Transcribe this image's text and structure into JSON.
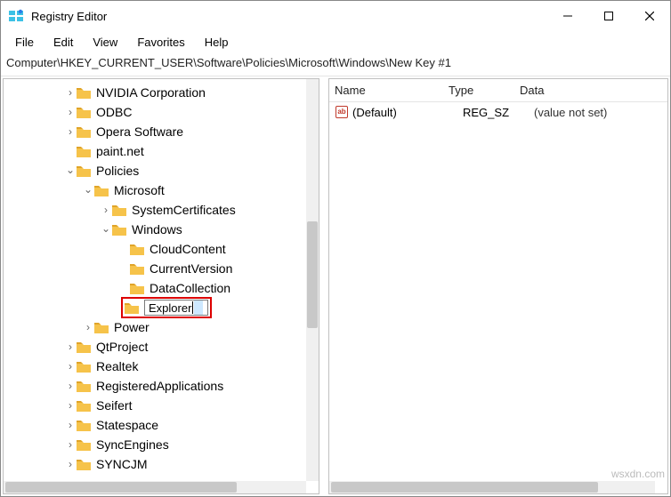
{
  "window": {
    "title": "Registry Editor"
  },
  "menus": {
    "file": "File",
    "edit": "Edit",
    "view": "View",
    "favorites": "Favorites",
    "help": "Help"
  },
  "address": "Computer\\HKEY_CURRENT_USER\\Software\\Policies\\Microsoft\\Windows\\New Key #1",
  "tree": {
    "nvidia": "NVIDIA Corporation",
    "odbc": "ODBC",
    "opera": "Opera Software",
    "paintnet": "paint.net",
    "policies": "Policies",
    "microsoft": "Microsoft",
    "systemcerts": "SystemCertificates",
    "windows": "Windows",
    "cloudcontent": "CloudContent",
    "currentversion": "CurrentVersion",
    "datacollection": "DataCollection",
    "explorer_input": "Explorer",
    "power": "Power",
    "qtproject": "QtProject",
    "realtek": "Realtek",
    "regapps": "RegisteredApplications",
    "seifert": "Seifert",
    "statespace": "Statespace",
    "syncengines": "SyncEngines",
    "syncjm": "SYNCJM"
  },
  "columns": {
    "name": "Name",
    "type": "Type",
    "data": "Data"
  },
  "values": [
    {
      "icon": "ab",
      "name": "(Default)",
      "type": "REG_SZ",
      "data": "(value not set)"
    }
  ],
  "watermark": "wsxdn.com"
}
